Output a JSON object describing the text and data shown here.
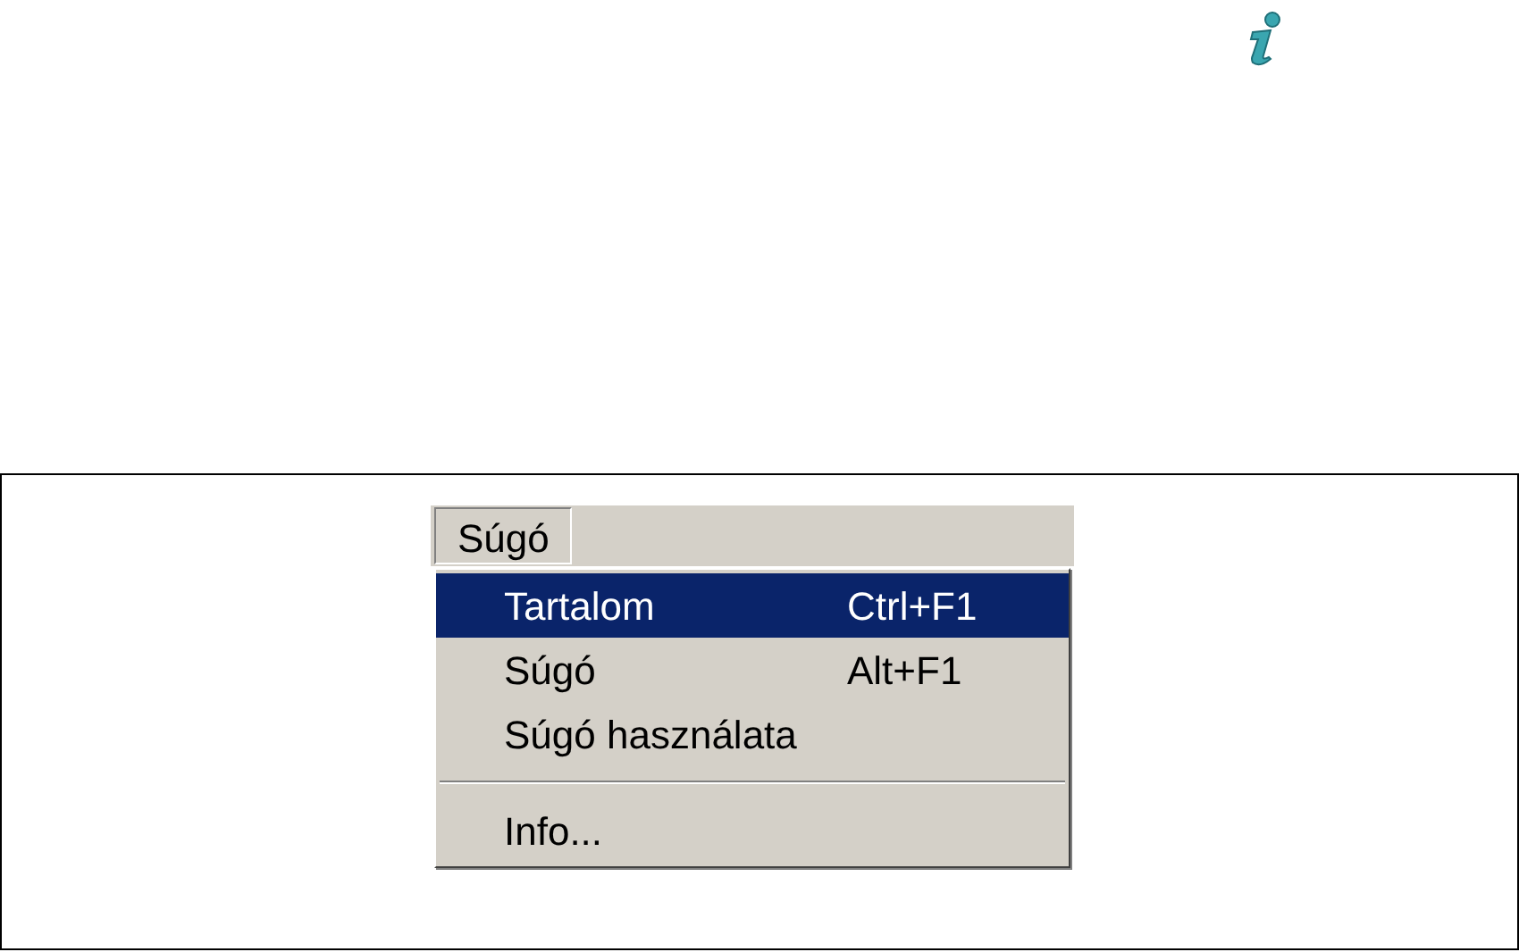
{
  "menu_bar": [
    {
      "label": "Súgó",
      "selected": true
    }
  ],
  "menu_items": [
    {
      "kind": "item",
      "label": "Tartalom",
      "shortcut": "Ctrl+F1",
      "selected": true
    },
    {
      "kind": "item",
      "label": "Súgó",
      "shortcut": "Alt+F1",
      "selected": false
    },
    {
      "kind": "item",
      "label": "Súgó használata",
      "selected": false
    },
    {
      "kind": "separator"
    },
    {
      "kind": "item",
      "label": "Info...",
      "selected": false
    }
  ]
}
